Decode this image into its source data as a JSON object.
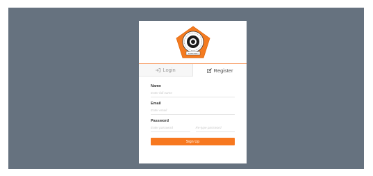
{
  "brand": {
    "logo_caption": "ALWASHLI"
  },
  "tabs": [
    {
      "label": "Login",
      "icon": "sign-in-icon"
    },
    {
      "label": "Register",
      "icon": "edit-icon"
    }
  ],
  "form": {
    "name": {
      "label": "Name",
      "placeholder": "Enter full name"
    },
    "email": {
      "label": "Email",
      "placeholder": "Enter email"
    },
    "password": {
      "label": "Password",
      "placeholder": "Enter password",
      "confirm_placeholder": "Re-type password"
    },
    "submit_label": "Sign Up"
  },
  "colors": {
    "backdrop": "#66727f",
    "accent": "#f7781f"
  }
}
